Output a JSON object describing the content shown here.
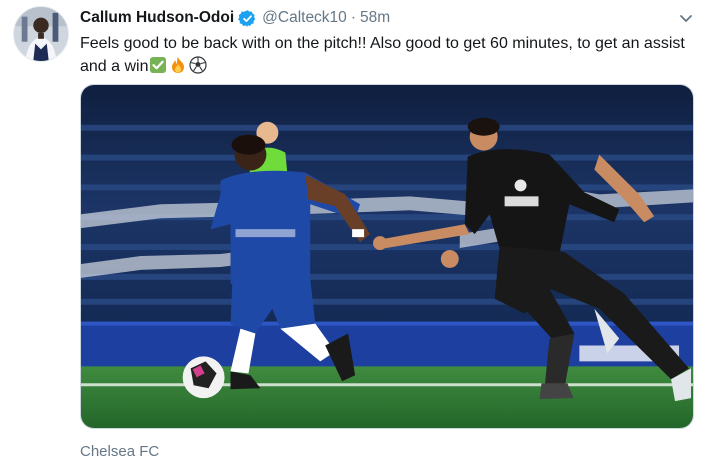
{
  "tweet": {
    "display_name": "Callum Hudson-Odoi",
    "handle": "@Calteck10",
    "separator": "·",
    "time": "58m",
    "text": "Feels good to be back with on the pitch!! Also good to get 60 minutes, to get an assist and a win",
    "emojis": [
      "check-mark-emoji",
      "fire-emoji",
      "soccer-ball-emoji"
    ],
    "attribution": "Chelsea FC"
  },
  "colors": {
    "verified": "#1da1f2",
    "secondary_text": "#657786",
    "chelsea_blue": "#1f49a6",
    "pitch_green": "#2f7a34"
  },
  "icons": {
    "caret": "chevron-down-icon",
    "verified": "verified-badge-icon"
  }
}
